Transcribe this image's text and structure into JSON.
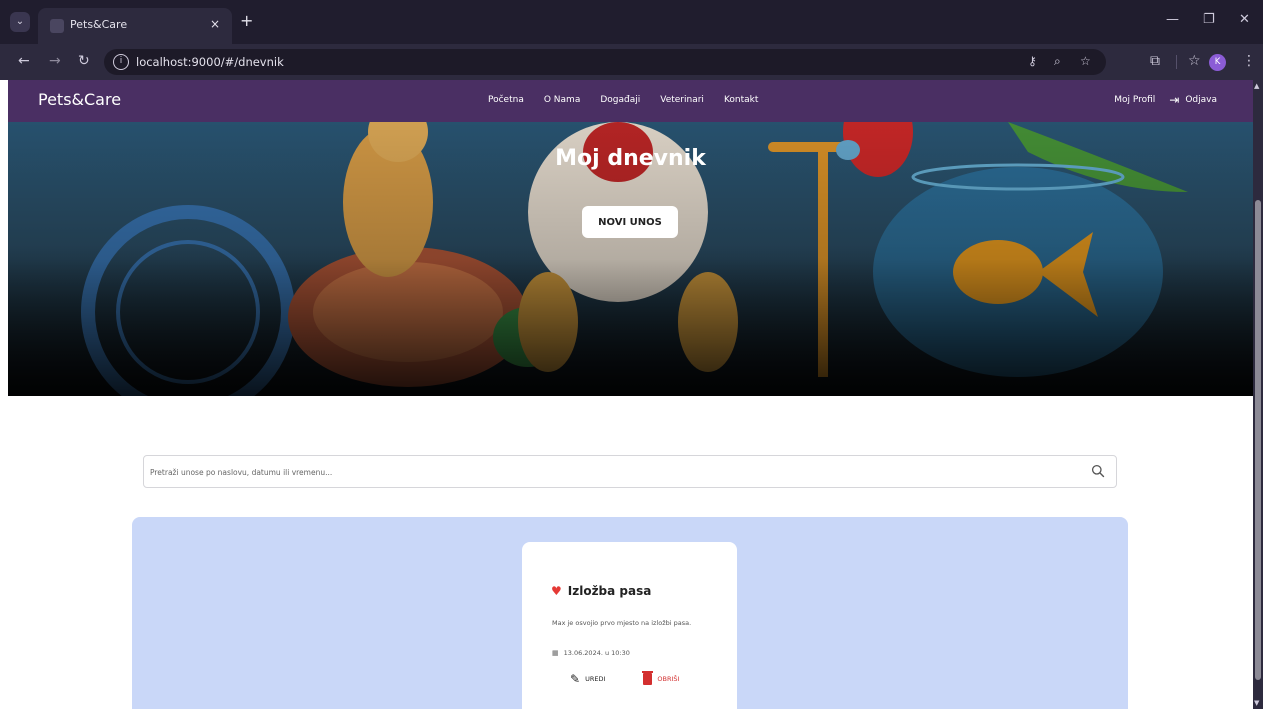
{
  "browser": {
    "tab_title": "Pets&Care",
    "tab_close": "×",
    "new_tab": "+",
    "url": "localhost:9000/#/dnevnik",
    "profile_initial": "K"
  },
  "navbar": {
    "brand": "Pets&Care",
    "links": [
      "Početna",
      "O Nama",
      "Događaji",
      "Veterinari",
      "Kontakt"
    ],
    "profile": "Moj Profil",
    "logout": "Odjava"
  },
  "hero": {
    "title": "Moj dnevnik",
    "new_entry": "NOVI UNOS"
  },
  "search": {
    "placeholder": "Pretraži unose po naslovu, datumu ili vremenu..."
  },
  "entries": [
    {
      "title": "Izložba pasa",
      "description": "Max je osvojio prvo mjesto na izložbi pasa.",
      "datetime": "13.06.2024. u 10:30",
      "edit_label": "UREDI",
      "delete_label": "OBRIŠI"
    }
  ],
  "colors": {
    "navbar": "#4a2f63",
    "entries_bg": "#c9d7f8",
    "delete": "#d32f2f",
    "heart": "#e53935"
  }
}
